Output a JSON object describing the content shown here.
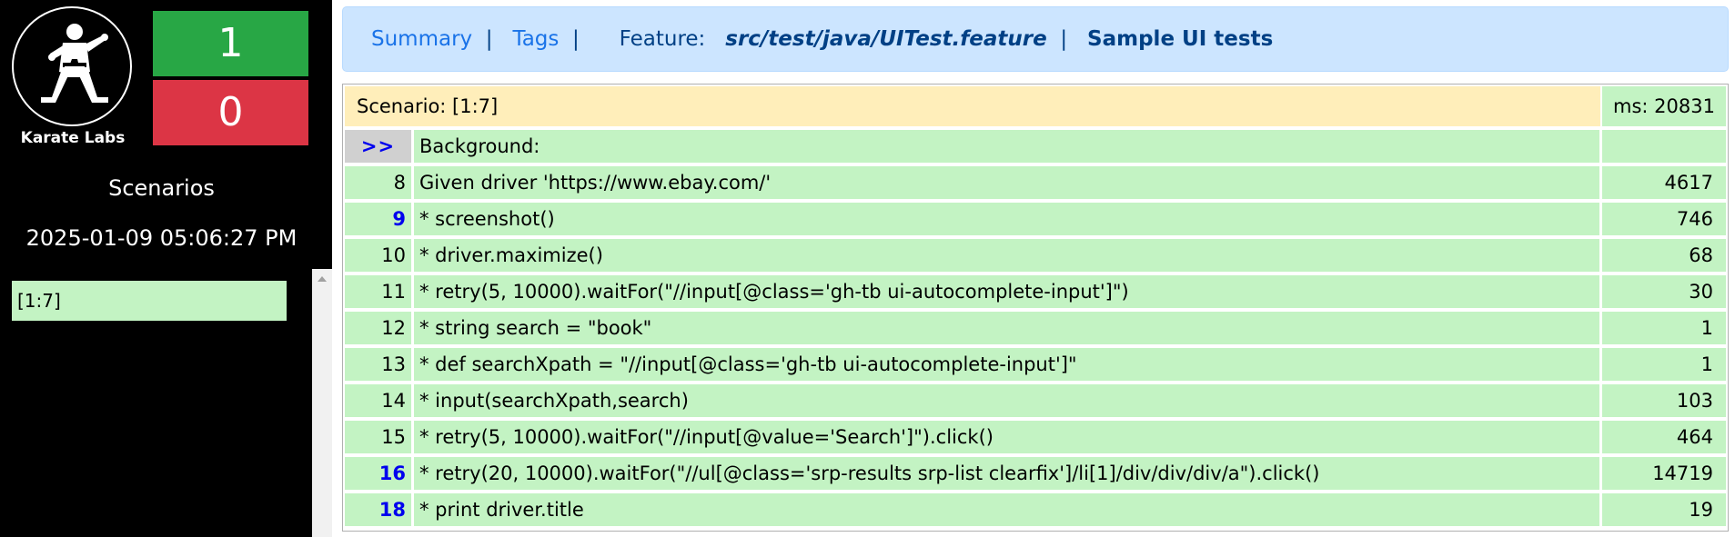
{
  "sidebar": {
    "logo_text": "Karate Labs",
    "passed_count": "1",
    "failed_count": "0",
    "scenarios_label": "Scenarios",
    "timestamp": "2025-01-09 05:06:27 PM",
    "scenario_links": [
      "[1:7]"
    ]
  },
  "header": {
    "summary_link": "Summary",
    "tags_link": "Tags",
    "separator": "|",
    "feature_label": "Feature:",
    "feature_path": "src/test/java/UITest.feature",
    "feature_title": "Sample UI tests"
  },
  "scenario": {
    "title": "Scenario: [1:7]",
    "duration": "ms: 20831",
    "steps": [
      {
        "line": ">>",
        "text": "Background:",
        "ms": "",
        "kind": "marker"
      },
      {
        "line": "8",
        "text": "Given driver 'https://www.ebay.com/'",
        "ms": "4617",
        "kind": "normal"
      },
      {
        "line": "9",
        "text": "* screenshot()",
        "ms": "746",
        "kind": "highlight"
      },
      {
        "line": "10",
        "text": "* driver.maximize()",
        "ms": "68",
        "kind": "normal"
      },
      {
        "line": "11",
        "text": "* retry(5, 10000).waitFor(\"//input[@class='gh-tb ui-autocomplete-input']\")",
        "ms": "30",
        "kind": "normal"
      },
      {
        "line": "12",
        "text": "* string search = \"book\"",
        "ms": "1",
        "kind": "normal"
      },
      {
        "line": "13",
        "text": "* def searchXpath = \"//input[@class='gh-tb ui-autocomplete-input']\"",
        "ms": "1",
        "kind": "normal"
      },
      {
        "line": "14",
        "text": "* input(searchXpath,search)",
        "ms": "103",
        "kind": "normal"
      },
      {
        "line": "15",
        "text": "* retry(5, 10000).waitFor(\"//input[@value='Search']\").click()",
        "ms": "464",
        "kind": "normal"
      },
      {
        "line": "16",
        "text": "* retry(20, 10000).waitFor(\"//ul[@class='srp-results srp-list clearfix']/li[1]/div/div/div/a\").click()",
        "ms": "14719",
        "kind": "highlight"
      },
      {
        "line": "18",
        "text": "* print driver.title",
        "ms": "19",
        "kind": "highlight"
      }
    ]
  },
  "colors": {
    "pass": "#28a745",
    "fail": "#dc3545",
    "step_bg": "#c3f3c3",
    "scenario_bg": "#ffeeba",
    "header_bg": "#cce5ff",
    "link": "#1a73e8"
  },
  "icons": {
    "logo": "karate-figure-icon",
    "scroll_up": "scroll-up-arrow-icon"
  }
}
